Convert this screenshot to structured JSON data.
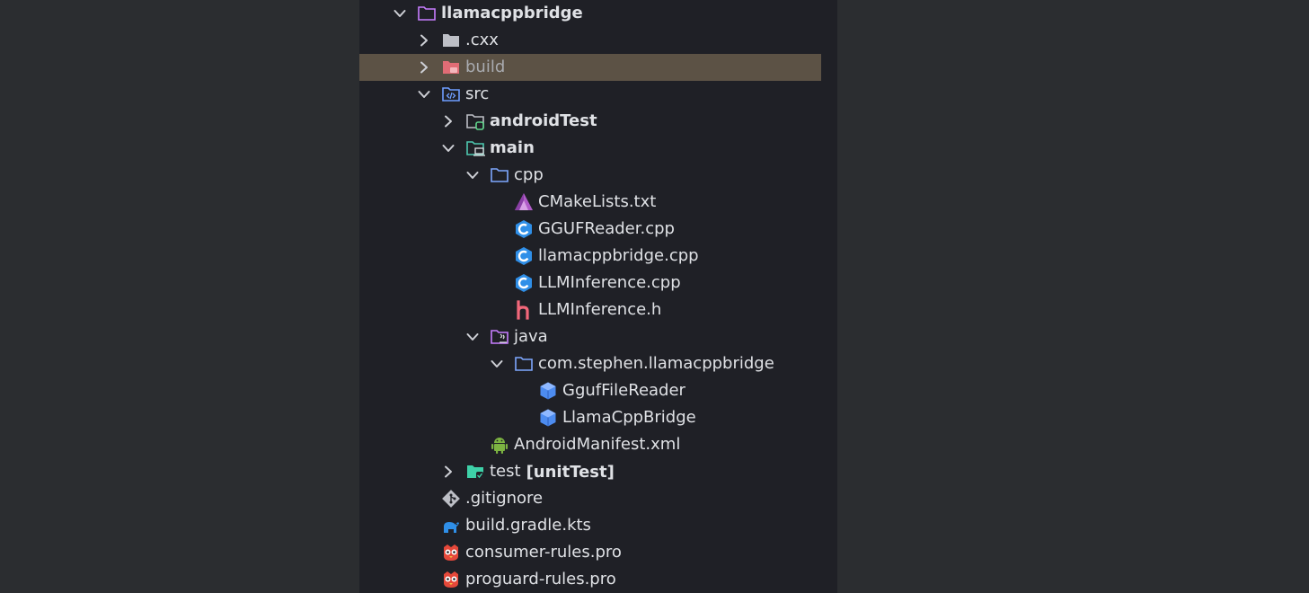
{
  "project_tree": {
    "rows": [
      {
        "label": "llamacppbridge",
        "chevron": "down",
        "icon": "module-folder-icon",
        "bold": true
      },
      {
        "label": ".cxx",
        "chevron": "right",
        "icon": "folder-icon"
      },
      {
        "label": "build",
        "chevron": "right",
        "icon": "excluded-folder-icon",
        "selected": true
      },
      {
        "label": "src",
        "chevron": "down",
        "icon": "source-folder-icon"
      },
      {
        "label": "androidTest",
        "chevron": "right",
        "icon": "test-folder-icon",
        "bold": true
      },
      {
        "label": "main",
        "chevron": "down",
        "icon": "main-folder-icon",
        "bold": true
      },
      {
        "label": "cpp",
        "chevron": "down",
        "icon": "folder-outline-icon"
      },
      {
        "label": "CMakeLists.txt",
        "icon": "cmake-icon"
      },
      {
        "label": "GGUFReader.cpp",
        "icon": "cpp-file-icon"
      },
      {
        "label": "llamacppbridge.cpp",
        "icon": "cpp-file-icon"
      },
      {
        "label": "LLMInference.cpp",
        "icon": "cpp-file-icon"
      },
      {
        "label": "LLMInference.h",
        "icon": "header-file-icon"
      },
      {
        "label": "java",
        "chevron": "down",
        "icon": "java-folder-icon"
      },
      {
        "label": "com.stephen.llamacppbridge",
        "chevron": "down",
        "icon": "package-folder-icon"
      },
      {
        "label": "GgufFileReader",
        "icon": "class-icon"
      },
      {
        "label": "LlamaCppBridge",
        "icon": "class-icon"
      },
      {
        "label": "AndroidManifest.xml",
        "icon": "android-icon"
      },
      {
        "label": "test",
        "suffix": "[unitTest]",
        "chevron": "right",
        "icon": "unit-test-folder-icon"
      },
      {
        "label": ".gitignore",
        "icon": "git-icon"
      },
      {
        "label": "build.gradle.kts",
        "icon": "gradle-icon"
      },
      {
        "label": "consumer-rules.pro",
        "icon": "proguard-icon"
      },
      {
        "label": "proguard-rules.pro",
        "icon": "proguard-icon"
      }
    ]
  },
  "colors": {
    "panel_background": "#1f2026",
    "outer_background": "#2b2d30",
    "selection": "#5c5245",
    "text": "#dfe1e5",
    "excluded_text": "#a9abb0"
  }
}
